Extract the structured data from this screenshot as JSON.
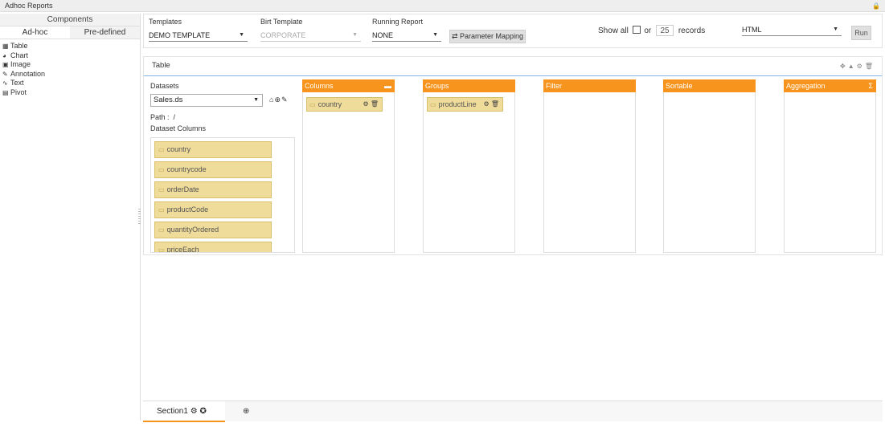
{
  "app": {
    "title": "Adhoc Reports"
  },
  "sidebar": {
    "header": "Components",
    "tabs": [
      "Ad-hoc",
      "Pre-defined"
    ],
    "items": [
      {
        "icon": "table-icon",
        "label": "Table"
      },
      {
        "icon": "chart-icon",
        "label": "Chart"
      },
      {
        "icon": "image-icon",
        "label": "Image"
      },
      {
        "icon": "annotation-icon",
        "label": "Annotation"
      },
      {
        "icon": "text-icon",
        "label": "Text"
      },
      {
        "icon": "pivot-icon",
        "label": "Pivot"
      }
    ]
  },
  "toolbar": {
    "templates_label": "Templates",
    "templates_value": "DEMO TEMPLATE",
    "birt_label": "Birt Template",
    "birt_value": "CORPORATE",
    "running_label": "Running Report",
    "running_value": "NONE",
    "param_mapping": "⇄ Parameter Mapping",
    "show_all": "Show all",
    "or": "or",
    "records_count": "25",
    "records": "records",
    "format_value": "HTML",
    "run": "Run"
  },
  "panel": {
    "title": "Table",
    "datasets_label": "Datasets",
    "dataset_value": "Sales.ds",
    "path_label": "Path :",
    "path_value": "/",
    "dataset_columns_label": "Dataset Columns",
    "dataset_columns": [
      "country",
      "countrycode",
      "orderDate",
      "productCode",
      "quantityOrdered",
      "priceEach"
    ]
  },
  "zones": {
    "columns": {
      "label": "Columns",
      "items": [
        "country"
      ]
    },
    "groups": {
      "label": "Groups",
      "items": [
        "productLine"
      ]
    },
    "filter": {
      "label": "Filter"
    },
    "sortable": {
      "label": "Sortable"
    },
    "aggregation": {
      "label": "Aggregation",
      "symbol": "Σ"
    }
  },
  "bottom": {
    "section_tab": "Section1"
  },
  "colors": {
    "accent": "#f7941d",
    "column_chip": "#efdb9a"
  }
}
